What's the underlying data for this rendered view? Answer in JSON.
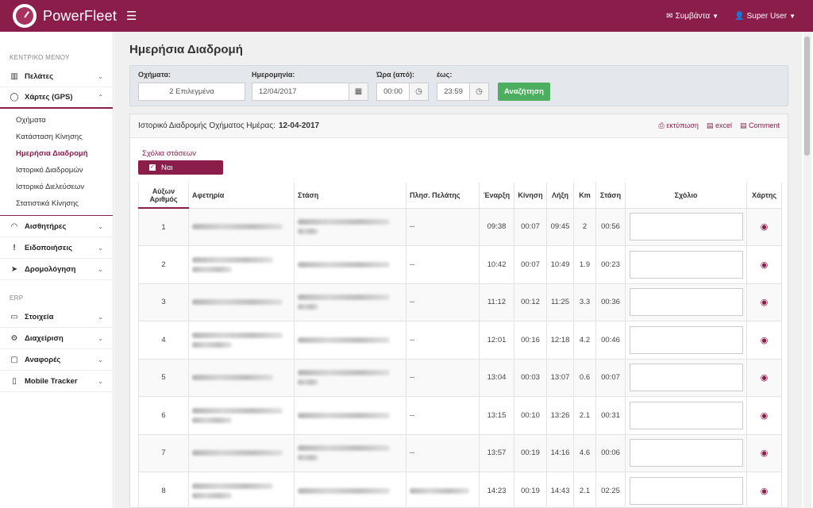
{
  "header": {
    "brand": "PowerFleet",
    "events": "Συμβάντα",
    "user": "Super User"
  },
  "sidebar": {
    "main_menu_heading": "ΚΕΝΤΡΙΚΟ ΜΕΝΟΥ",
    "items_top": [
      {
        "label": "Πελάτες",
        "icon": "map-icon"
      },
      {
        "label": "Χάρτες (GPS)",
        "icon": "globe-icon"
      }
    ],
    "gps_submenu": [
      {
        "label": "Οχήματα"
      },
      {
        "label": "Κατάσταση Κίνησης"
      },
      {
        "label": "Ημερήσια Διαδρομή"
      },
      {
        "label": "Ιστορικό Διαδρομών"
      },
      {
        "label": "Ιστορικό Διελεύσεων"
      },
      {
        "label": "Στατιστικά Κίνησης"
      }
    ],
    "items_mid": [
      {
        "label": "Αισθητήρες",
        "icon": "gauge-icon"
      },
      {
        "label": "Ειδοποιήσεις",
        "icon": "exclamation-icon"
      },
      {
        "label": "Δρομολόγηση",
        "icon": "location-arrow-icon"
      }
    ],
    "erp_heading": "ERP",
    "items_erp": [
      {
        "label": "Στοιχεία",
        "icon": "car-icon"
      },
      {
        "label": "Διαχείριση",
        "icon": "cog-icon"
      },
      {
        "label": "Αναφορές",
        "icon": "monitor-icon"
      },
      {
        "label": "Mobile Tracker",
        "icon": "mobile-icon"
      }
    ]
  },
  "page": {
    "title": "Ημερήσια Διαδρομή"
  },
  "filters": {
    "vehicles_label": "Οχήματα:",
    "vehicles_value": "2 Επιλεγμένα",
    "date_label": "Ημερομηνία:",
    "date_value": "12/04/2017",
    "time_from_label": "Ώρα (από):",
    "time_from_value": "00:00",
    "time_to_label": "έως:",
    "time_to_value": "23:59",
    "search_label": "Αναζήτηση"
  },
  "panel": {
    "heading": "Ιστορικό Διαδρομής Οχήματος Ημέρας:",
    "heading_date": "12-04-2017",
    "print": "εκτύπωση",
    "excel": "excel",
    "comment": "Comment",
    "stop_comments_label": "Σχόλια στάσεων",
    "yes_label": "Ναι"
  },
  "table": {
    "headers": {
      "num": "Αύξων Αριθμός",
      "start": "Αφετηρία",
      "stop": "Στάση",
      "near": "Πλησ. Πελάτης",
      "begin": "Έναρξη",
      "move": "Κίνηση",
      "end": "Λήξη",
      "km": "Km",
      "halt": "Στάση",
      "comment": "Σχόλιο",
      "map": "Χάρτης"
    },
    "rows": [
      {
        "num": "1",
        "near": "--",
        "begin": "09:38",
        "move": "00:07",
        "end": "09:45",
        "km": "2",
        "halt": "00:56"
      },
      {
        "num": "2",
        "near": "--",
        "begin": "10:42",
        "move": "00:07",
        "end": "10:49",
        "km": "1.9",
        "halt": "00:23"
      },
      {
        "num": "3",
        "near": "--",
        "begin": "11:12",
        "move": "00:12",
        "end": "11:25",
        "km": "3.3",
        "halt": "00:36"
      },
      {
        "num": "4",
        "near": "--",
        "begin": "12:01",
        "move": "00:16",
        "end": "12:18",
        "km": "4.2",
        "halt": "00:46"
      },
      {
        "num": "5",
        "near": "--",
        "begin": "13:04",
        "move": "00:03",
        "end": "13:07",
        "km": "0.6",
        "halt": "00:07"
      },
      {
        "num": "6",
        "near": "--",
        "begin": "13:15",
        "move": "00:10",
        "end": "13:26",
        "km": "2.1",
        "halt": "00:31"
      },
      {
        "num": "7",
        "near": "--",
        "begin": "13:57",
        "move": "00:19",
        "end": "14:16",
        "km": "4.6",
        "halt": "00:06"
      },
      {
        "num": "8",
        "near": "",
        "begin": "14:23",
        "move": "00:19",
        "end": "14:43",
        "km": "2.1",
        "halt": "02:25"
      }
    ]
  }
}
